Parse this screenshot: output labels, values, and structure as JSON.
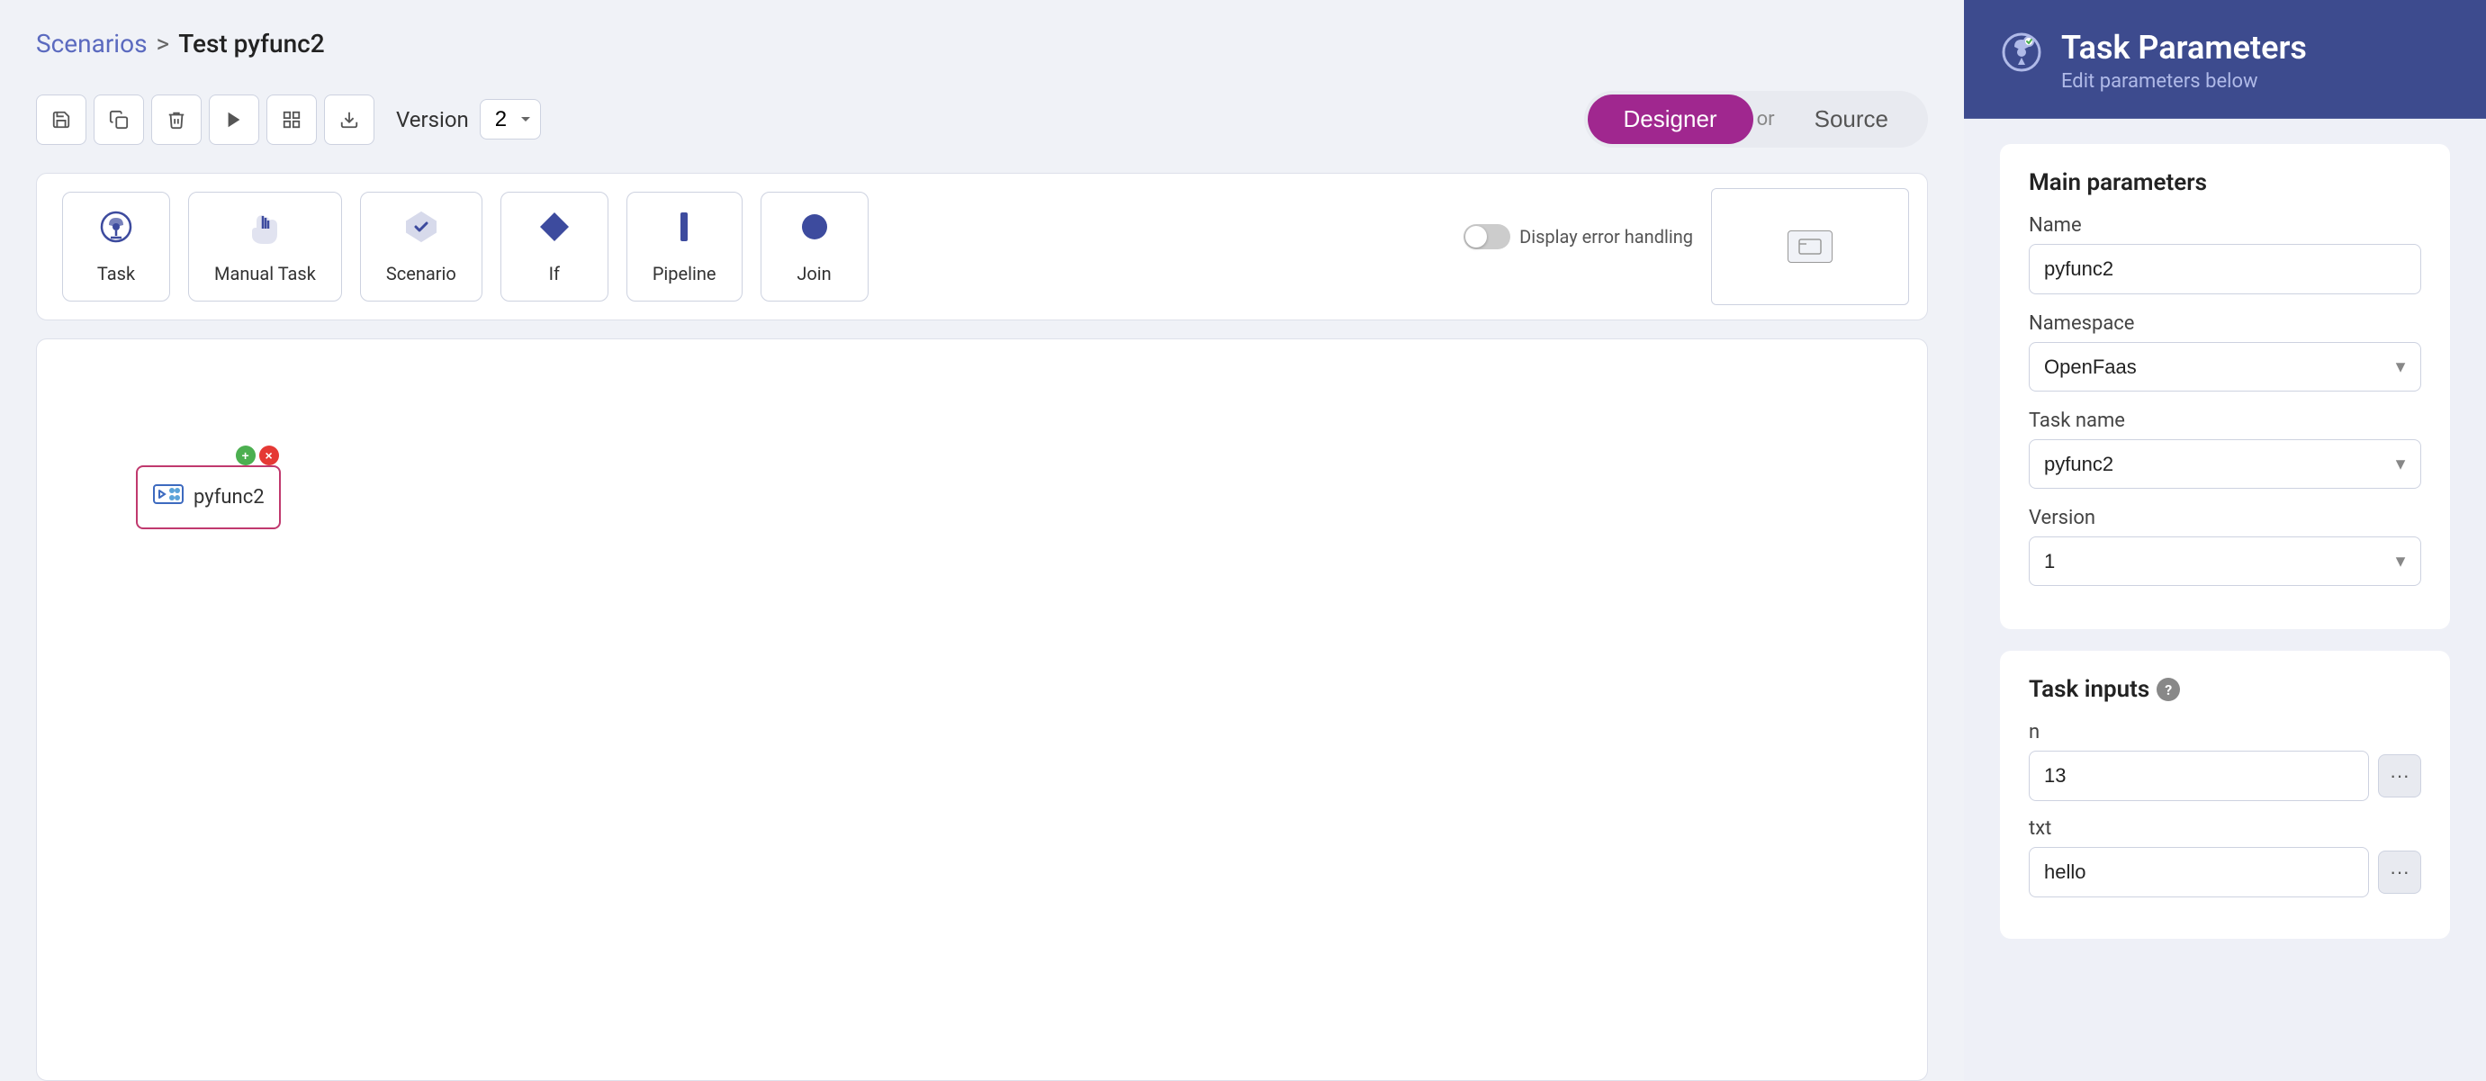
{
  "breadcrumb": {
    "scenarios_label": "Scenarios",
    "separator": ">",
    "current": "Test pyfunc2"
  },
  "toolbar": {
    "save_label": "💾",
    "copy_label": "📋",
    "delete_label": "🗑",
    "run_label": "▶",
    "grid_label": "⊞",
    "download_label": "⬇",
    "version_label": "Version",
    "version_value": "2",
    "designer_label": "Designer",
    "or_label": "or",
    "source_label": "Source"
  },
  "components": [
    {
      "id": "task",
      "icon": "⚙️",
      "label": "Task"
    },
    {
      "id": "manual-task",
      "icon": "✋",
      "label": "Manual Task"
    },
    {
      "id": "scenario",
      "icon": "🧩",
      "label": "Scenario"
    },
    {
      "id": "if",
      "icon": "◆",
      "label": "If"
    },
    {
      "id": "pipeline",
      "icon": "▮",
      "label": "Pipeline"
    },
    {
      "id": "join",
      "icon": "⬤",
      "label": "Join"
    }
  ],
  "error_handling": {
    "label": "Display error handling"
  },
  "canvas_node": {
    "label": "pyfunc2"
  },
  "right_panel": {
    "title": "Task Parameters",
    "subtitle": "Edit parameters below",
    "main_params_title": "Main parameters",
    "name_label": "Name",
    "name_value": "pyfunc2",
    "namespace_label": "Namespace",
    "namespace_value": "OpenFaas",
    "task_name_label": "Task name",
    "task_name_value": "pyfunc2",
    "version_label": "Version",
    "version_value": "1",
    "task_inputs_title": "Task inputs",
    "input_n_label": "n",
    "input_n_value": "13",
    "input_txt_label": "txt",
    "input_txt_value": "hello"
  }
}
